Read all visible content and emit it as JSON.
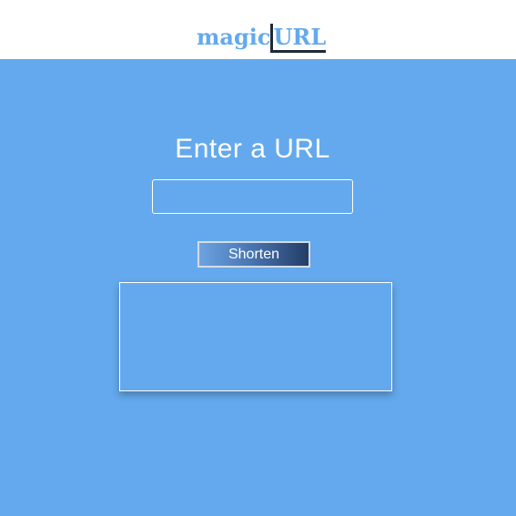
{
  "header": {
    "logo_part_a": "magic",
    "logo_part_b": "URL"
  },
  "main": {
    "heading": "Enter a URL",
    "url_input": {
      "value": "",
      "placeholder": ""
    },
    "shorten_label": "Shorten",
    "result_text": ""
  },
  "colors": {
    "brand_blue": "#64a9ed",
    "logo_text": "#63a9ed",
    "logo_underline": "#1e2a3a",
    "button_gradient_start": "#6ba3e0",
    "button_gradient_end": "#243d66"
  }
}
